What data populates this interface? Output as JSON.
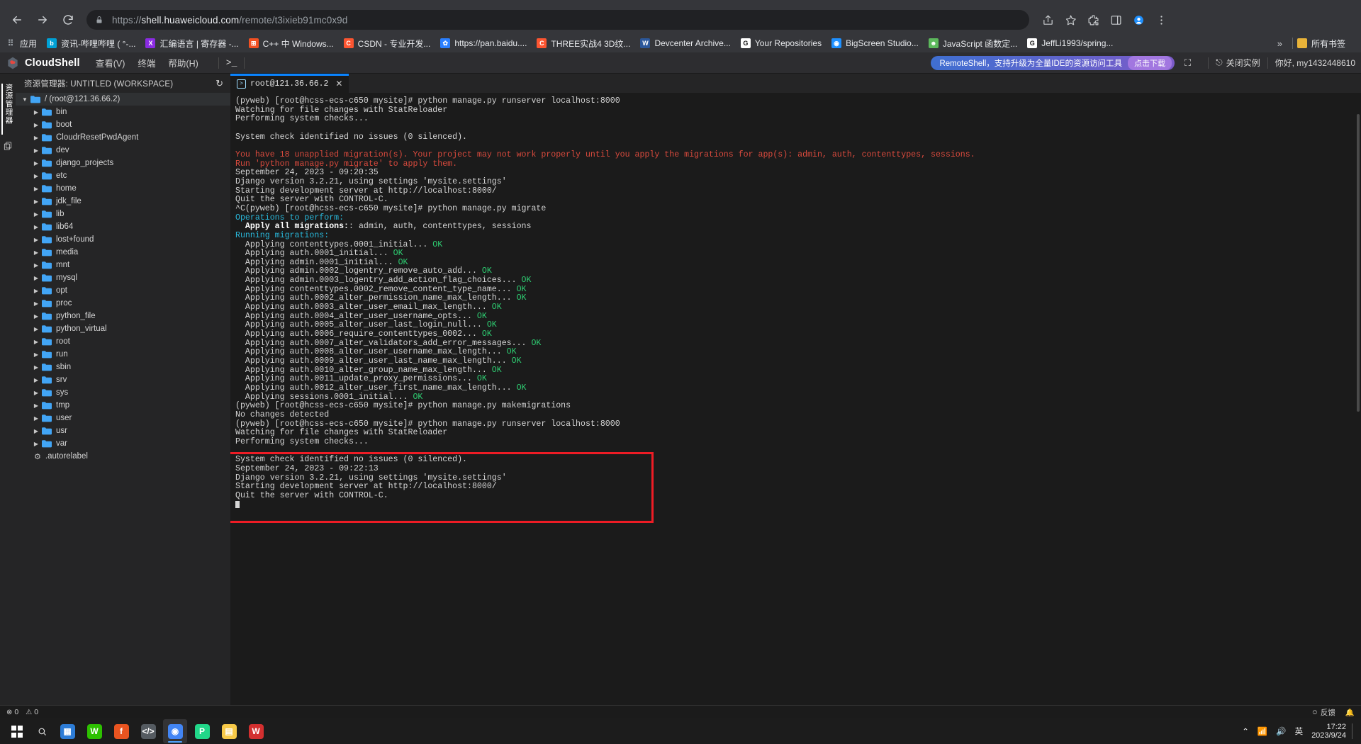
{
  "browser": {
    "url_prefix": "https://",
    "url_domain": "shell.huaweicloud.com",
    "url_path": "/remote/t3ixieb91mc0x9d",
    "back_icon": "back-arrow-icon",
    "forward_icon": "forward-arrow-icon",
    "reload_icon": "reload-icon",
    "lock_icon": "lock-icon",
    "share_icon": "share-icon",
    "star_icon": "star-icon",
    "extensions_icon": "puzzle-icon",
    "sidepanel_icon": "side-panel-icon",
    "profile_icon": "profile-avatar-icon",
    "menu_icon": "three-dot-menu-icon",
    "bookmarks": [
      {
        "label": "应用",
        "fav": "apps-grid-icon",
        "color": "none",
        "letter": "⠿"
      },
      {
        "label": "资讯-哔哩哔哩 ( °-...",
        "fav": "bilibili-icon",
        "color": "#00a1d6",
        "letter": "b"
      },
      {
        "label": "汇编语言 | 寄存器 -...",
        "fav": "vscode-icon",
        "color": "#8a2be2",
        "letter": "X"
      },
      {
        "label": "C++ 中 Windows...",
        "fav": "microsoft-icon",
        "color": "#f25022",
        "letter": "⊞"
      },
      {
        "label": "CSDN - 专业开发...",
        "fav": "csdn-icon",
        "color": "#fc5531",
        "letter": "C"
      },
      {
        "label": "https://pan.baidu....",
        "fav": "baidu-icon",
        "color": "#2a7fff",
        "letter": "✿"
      },
      {
        "label": "THREE实战4 3D纹...",
        "fav": "c-icon",
        "color": "#fc5531",
        "letter": "C"
      },
      {
        "label": "Devcenter Archive...",
        "fav": "w-icon",
        "color": "#2b579a",
        "letter": "W"
      },
      {
        "label": "Your Repositories",
        "fav": "github-icon",
        "color": "#ffffff",
        "letter": "G"
      },
      {
        "label": "BigScreen Studio...",
        "fav": "bigscreen-icon",
        "color": "#1e90ff",
        "letter": "◉"
      },
      {
        "label": "JavaScript 函数定...",
        "fav": "js-icon",
        "color": "#5cb85c",
        "letter": "☻"
      },
      {
        "label": "JeffLi1993/spring...",
        "fav": "github-icon",
        "color": "#ffffff",
        "letter": "G"
      }
    ],
    "overflow_label": "»",
    "all_bookmarks_label": "所有书签",
    "all_bookmarks_icon": "folder-icon"
  },
  "cloudshell": {
    "logo_icon": "cloudshell-logo-icon",
    "title": "CloudShell",
    "menus": [
      "查看(V)",
      "终端",
      "帮助(H)"
    ],
    "terminal_icon": ">_",
    "promo_text": "RemoteShell，支持升级为全量IDE的资源访问工具",
    "promo_button": "点击下载",
    "fullscreen_icon": "fullscreen-icon",
    "close_instance_icon": "logout-icon",
    "close_instance_label": "关闭实例",
    "greeting": "你好, my1432448610"
  },
  "rail": {
    "explorer_label": "资源管理器",
    "copy_icon": "copy-files-icon"
  },
  "explorer": {
    "title": "资源管理器: UNTITLED (WORKSPACE)",
    "refresh_icon": "refresh-icon",
    "root": {
      "label": "/ (root@121.36.66.2)",
      "expanded": true
    },
    "folders": [
      "bin",
      "boot",
      "CloudrResetPwdAgent",
      "dev",
      "django_projects",
      "etc",
      "home",
      "jdk_file",
      "lib",
      "lib64",
      "lost+found",
      "media",
      "mnt",
      "mysql",
      "opt",
      "proc",
      "python_file",
      "python_virtual",
      "root",
      "run",
      "sbin",
      "srv",
      "sys",
      "tmp",
      "user",
      "usr",
      "var"
    ],
    "files": [
      {
        "label": ".autorelabel",
        "icon": "gear-file-icon"
      }
    ]
  },
  "terminal": {
    "tab": {
      "label": "root@121.36.66.2",
      "icon": "terminal-icon",
      "close_icon": "close-icon"
    },
    "lines": [
      {
        "t": "(pyweb) [root@hcss-ecs-c650 mysite]# python manage.py runserver localhost:8000",
        "c": "plain"
      },
      {
        "t": "Watching for file changes with StatReloader",
        "c": "plain"
      },
      {
        "t": "Performing system checks...",
        "c": "plain"
      },
      {
        "t": "",
        "c": "plain"
      },
      {
        "t": "System check identified no issues (0 silenced).",
        "c": "plain"
      },
      {
        "t": "",
        "c": "plain"
      },
      {
        "t": "You have 18 unapplied migration(s). Your project may not work properly until you apply the migrations for app(s): admin, auth, contenttypes, sessions.",
        "c": "red"
      },
      {
        "t": "Run 'python manage.py migrate' to apply them.",
        "c": "red"
      },
      {
        "t": "September 24, 2023 - 09:20:35",
        "c": "plain"
      },
      {
        "t": "Django version 3.2.21, using settings 'mysite.settings'",
        "c": "plain"
      },
      {
        "t": "Starting development server at http://localhost:8000/",
        "c": "plain"
      },
      {
        "t": "Quit the server with CONTROL-C.",
        "c": "plain"
      },
      {
        "t": "^C(pyweb) [root@hcss-ecs-c650 mysite]# python manage.py migrate",
        "c": "plain"
      },
      {
        "t": "Operations to perform:",
        "c": "cyan"
      },
      {
        "t": "  Apply all migrations:|: admin, auth, contenttypes, sessions",
        "c": "boldhead"
      },
      {
        "t": "Running migrations:",
        "c": "cyan"
      },
      {
        "t": "  Applying contenttypes.0001_initial...| OK",
        "c": "ok"
      },
      {
        "t": "  Applying auth.0001_initial...| OK",
        "c": "ok"
      },
      {
        "t": "  Applying admin.0001_initial...| OK",
        "c": "ok"
      },
      {
        "t": "  Applying admin.0002_logentry_remove_auto_add...| OK",
        "c": "ok"
      },
      {
        "t": "  Applying admin.0003_logentry_add_action_flag_choices...| OK",
        "c": "ok"
      },
      {
        "t": "  Applying contenttypes.0002_remove_content_type_name...| OK",
        "c": "ok"
      },
      {
        "t": "  Applying auth.0002_alter_permission_name_max_length...| OK",
        "c": "ok"
      },
      {
        "t": "  Applying auth.0003_alter_user_email_max_length...| OK",
        "c": "ok"
      },
      {
        "t": "  Applying auth.0004_alter_user_username_opts...| OK",
        "c": "ok"
      },
      {
        "t": "  Applying auth.0005_alter_user_last_login_null...| OK",
        "c": "ok"
      },
      {
        "t": "  Applying auth.0006_require_contenttypes_0002...| OK",
        "c": "ok"
      },
      {
        "t": "  Applying auth.0007_alter_validators_add_error_messages...| OK",
        "c": "ok"
      },
      {
        "t": "  Applying auth.0008_alter_user_username_max_length...| OK",
        "c": "ok"
      },
      {
        "t": "  Applying auth.0009_alter_user_last_name_max_length...| OK",
        "c": "ok"
      },
      {
        "t": "  Applying auth.0010_alter_group_name_max_length...| OK",
        "c": "ok"
      },
      {
        "t": "  Applying auth.0011_update_proxy_permissions...| OK",
        "c": "ok"
      },
      {
        "t": "  Applying auth.0012_alter_user_first_name_max_length...| OK",
        "c": "ok"
      },
      {
        "t": "  Applying sessions.0001_initial...| OK",
        "c": "ok"
      },
      {
        "t": "(pyweb) [root@hcss-ecs-c650 mysite]# python manage.py makemigrations",
        "c": "plain"
      },
      {
        "t": "No changes detected",
        "c": "plain"
      },
      {
        "t": "(pyweb) [root@hcss-ecs-c650 mysite]# python manage.py runserver localhost:8000",
        "c": "plain"
      },
      {
        "t": "Watching for file changes with StatReloader",
        "c": "plain"
      },
      {
        "t": "Performing system checks...",
        "c": "plain"
      },
      {
        "t": "",
        "c": "plain"
      },
      {
        "t": "System check identified no issues (0 silenced).",
        "c": "plain"
      },
      {
        "t": "September 24, 2023 - 09:22:13",
        "c": "plain"
      },
      {
        "t": "Django version 3.2.21, using settings 'mysite.settings'",
        "c": "plain"
      },
      {
        "t": "Starting development server at http://localhost:8000/",
        "c": "plain"
      },
      {
        "t": "Quit the server with CONTROL-C.",
        "c": "plain"
      },
      {
        "t": "CURSOR",
        "c": "cursor"
      }
    ],
    "highlight_color": "#ee1c25"
  },
  "status": {
    "errors_icon": "error-circle-icon",
    "errors": "0",
    "warnings_icon": "warning-triangle-icon",
    "warnings": "0",
    "feedback_icon": "smiley-icon",
    "feedback_label": "反馈",
    "bell_icon": "bell-icon"
  },
  "taskbar": {
    "start_icon": "windows-start-icon",
    "search_icon": "search-icon",
    "apps": [
      {
        "name": "task-view",
        "letter": "▦",
        "color": "#2d7cd6"
      },
      {
        "name": "wechat",
        "letter": "W",
        "color": "#2dc100"
      },
      {
        "name": "firefox",
        "letter": "f",
        "color": "#e95420"
      },
      {
        "name": "code-editor",
        "letter": "</>",
        "color": "#555b61"
      },
      {
        "name": "chrome",
        "letter": "◉",
        "color": "#4285f4",
        "active": true
      },
      {
        "name": "pycharm",
        "letter": "P",
        "color": "#21d789"
      },
      {
        "name": "file-explorer",
        "letter": "▤",
        "color": "#f7c948"
      },
      {
        "name": "wps",
        "letter": "W",
        "color": "#d32f2f"
      }
    ],
    "tray": {
      "chevron_icon": "chevron-up-icon",
      "network_icon": "network-icon",
      "volume_icon": "volume-icon",
      "ime_label": "英",
      "time": "17:22",
      "date": "2023/9/24"
    }
  }
}
